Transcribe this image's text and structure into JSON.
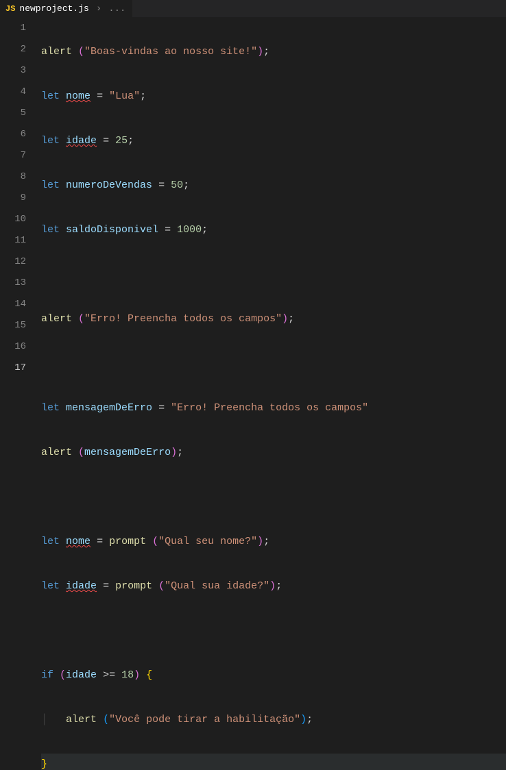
{
  "tab": {
    "icon_label": "JS",
    "filename": "newproject.js",
    "breadcrumb_sep": "›",
    "breadcrumb_rest": "..."
  },
  "code": {
    "alert": "alert",
    "let": "let",
    "prompt": "prompt",
    "if": "if",
    "nome": "nome",
    "idade": "idade",
    "numeroDeVendas": "numeroDeVendas",
    "saldoDisponivel": "saldoDisponivel",
    "mensagemDeErro": "mensagemDeErro",
    "eq": "=",
    "gte": ">=",
    "semi": ";",
    "open_p": "(",
    "close_p": ")",
    "open_b": "{",
    "close_b": "}",
    "pipe": "│",
    "str_boas": "\"Boas-vindas ao nosso site!\"",
    "str_lua": "\"Lua\"",
    "num_25": "25",
    "num_50": "50",
    "num_1000": "1000",
    "num_18": "18",
    "str_erro": "\"Erro! Preencha todos os campos\"",
    "str_qual_nome": "\"Qual seu nome?\"",
    "str_qual_idade": "\"Qual sua idade?\"",
    "str_habilitacao": "\"Você pode tirar a habilitação\""
  },
  "lines": [
    "1",
    "2",
    "3",
    "4",
    "5",
    "6",
    "7",
    "8",
    "9",
    "10",
    "11",
    "12",
    "13",
    "14",
    "15",
    "16",
    "17"
  ]
}
